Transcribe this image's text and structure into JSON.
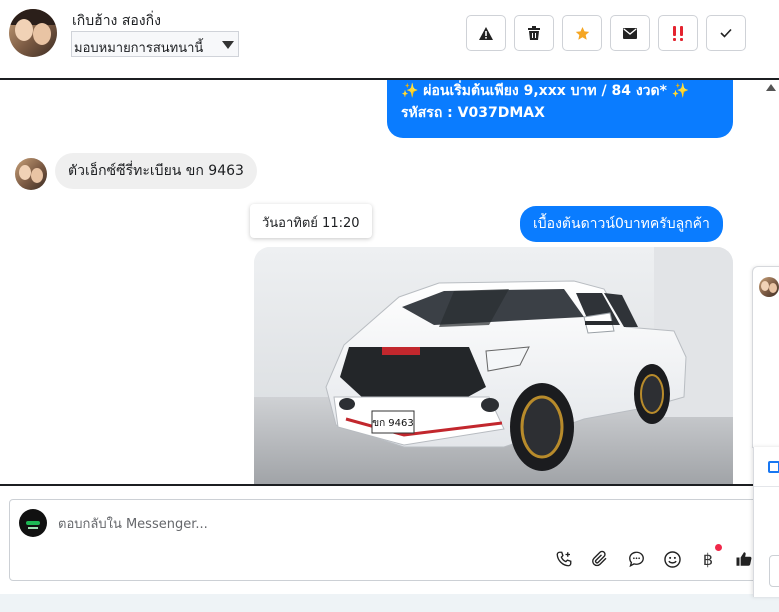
{
  "header": {
    "contact_name": "เกิบฮ้าง สองกิ่ง",
    "assign_label": "มอบหมายการสนทนานี้",
    "actions": [
      {
        "name": "spam",
        "icon": "warning-icon"
      },
      {
        "name": "delete",
        "icon": "trash-icon"
      },
      {
        "name": "follow-up",
        "icon": "star-icon",
        "color": "#f5a623"
      },
      {
        "name": "mark-unread",
        "icon": "envelope-icon"
      },
      {
        "name": "priority",
        "icon": "double-exclamation-icon",
        "color": "#e4242f"
      },
      {
        "name": "done",
        "icon": "checkmark-icon"
      }
    ]
  },
  "conversation": {
    "outgoing_partial_lines": [
      "✨ ผ่อนเริ่มต้นเพียง 9,xxx บาท / 84 งวด* ✨",
      "รหัสรถ : V037DMAX"
    ],
    "incoming_message": "ตัวเอ็กซ์ซีรี่ทะเบียน ขก 9463",
    "timestamp": "วันอาทิตย์ 11:20",
    "outgoing_message": "เบื้องต้นดาวน์0บาทครับลูกค้า",
    "photo_plate_text": "ขก 9463",
    "accent_color": "#0a7cff"
  },
  "composer": {
    "placeholder": "ตอบกลับใน Messenger...",
    "tools": [
      {
        "name": "call-plus",
        "icon": "phone-plus-icon"
      },
      {
        "name": "attach",
        "icon": "paperclip-icon"
      },
      {
        "name": "saved-replies",
        "icon": "chat-bubble-icon"
      },
      {
        "name": "emoji",
        "icon": "smiley-icon"
      },
      {
        "name": "payments",
        "icon": "baht-icon",
        "glyph": "฿"
      },
      {
        "name": "like",
        "icon": "thumbs-up-icon"
      }
    ]
  }
}
